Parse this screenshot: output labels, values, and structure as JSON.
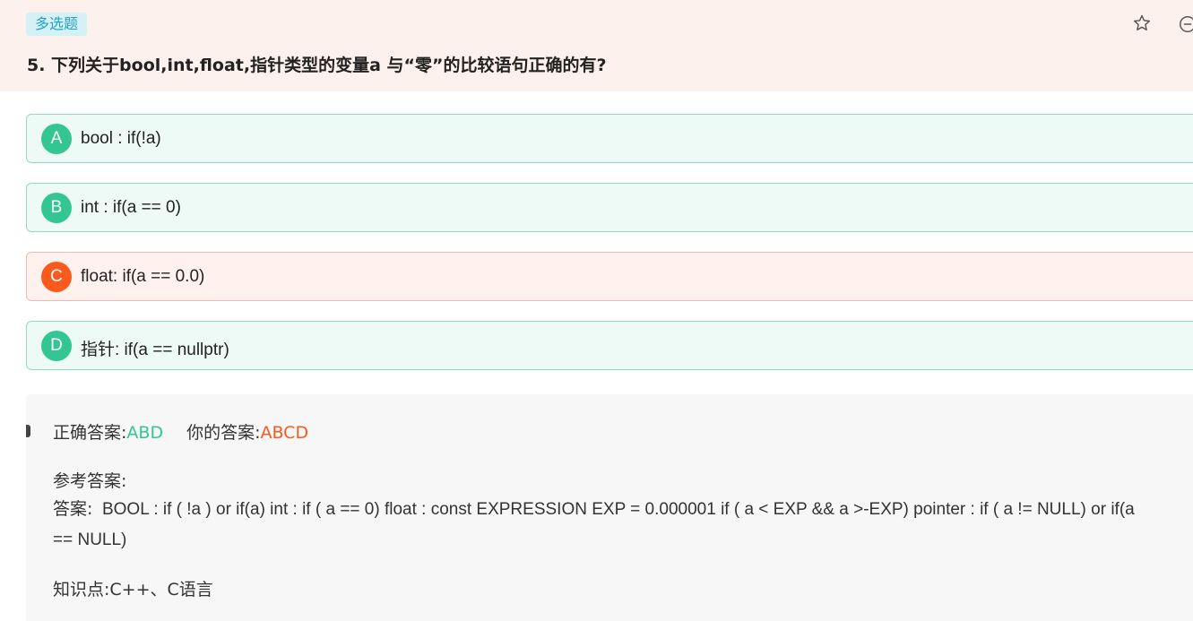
{
  "question": {
    "type_label": "多选题",
    "title": "5. 下列关于bool,int,float,指针类型的变量a 与“零”的比较语句正确的有?",
    "options": [
      {
        "letter": "A",
        "text": "bool : if(!a)",
        "state": "correct"
      },
      {
        "letter": "B",
        "text": "int : if(a == 0)",
        "state": "correct"
      },
      {
        "letter": "C",
        "text": "float: if(a == 0.0)",
        "state": "wrong"
      },
      {
        "letter": "D",
        "text": "指针: if(a == nullptr)",
        "state": "correct"
      }
    ]
  },
  "icons": {
    "favorite": "star-icon",
    "collapse": "minus-circle-icon"
  },
  "analysis": {
    "correct_label": "正确答案:",
    "correct_value": "ABD",
    "your_label": "你的答案:",
    "your_value": "ABCD",
    "reference_title": "参考答案:",
    "reference_label": "答案:",
    "reference_text": "BOOL : if ( !a ) or if(a) int : if ( a == 0) float : const EXPRESSION EXP = 0.000001 if ( a < EXP && a >-EXP) pointer : if ( a != NULL) or if(a == NULL)",
    "knowledge_label": "知识点:",
    "knowledge_value": "C++、C语言"
  },
  "colors": {
    "header_bg": "#fdf1ed",
    "correct": "#33c693",
    "wrong": "#fa5a1e",
    "badge_text": "#22a3c2"
  }
}
